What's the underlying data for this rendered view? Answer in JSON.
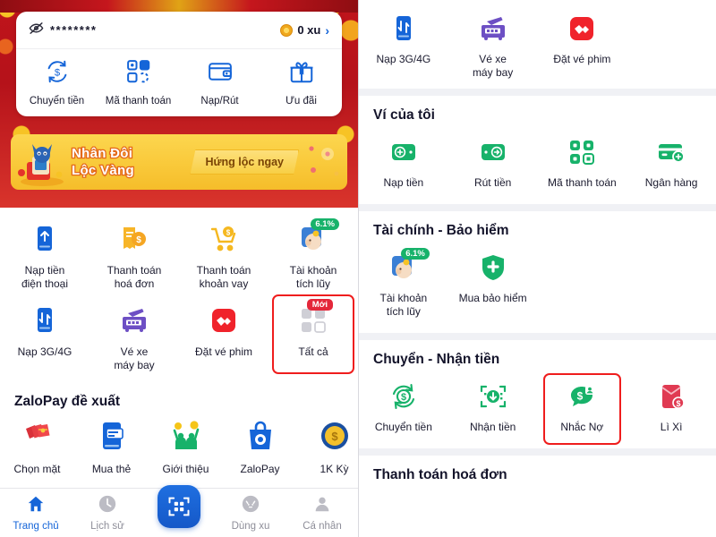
{
  "app": {
    "name": "ZaloPay",
    "language": "vi"
  },
  "colors": {
    "brand_blue": "#1565d8",
    "brand_green": "#17b26a",
    "highlight_red": "#ef1d1d",
    "badge_new_red": "#e4273a",
    "tet_red": "#c0141b",
    "promo_yellow": "#f9c93a"
  },
  "left_panel": {
    "balance_card": {
      "eye_icon": "eye-off-icon",
      "balance_masked": "********",
      "coin_icon": "coin-icon",
      "coin_value": "0 xu",
      "chevron": "chevron-right-icon",
      "quick_actions": [
        {
          "label": "Chuyển tiền",
          "icon": "transfer-money-icon"
        },
        {
          "label": "Mã thanh toán",
          "icon": "payment-qr-icon"
        },
        {
          "label": "Nạp/Rút",
          "icon": "wallet-icon"
        },
        {
          "label": "Ưu đãi",
          "icon": "gift-icon"
        }
      ]
    },
    "promo_banner": {
      "line1": "Nhân Đôi",
      "line2": "Lộc Vàng",
      "button_label": "Hứng lộc ngay",
      "mascot_icon": "cat-mascot-icon"
    },
    "services": [
      {
        "label": "Nạp tiền\nđiện thoại",
        "icon": "phone-topup-icon",
        "badge": null,
        "highlighted": false
      },
      {
        "label": "Thanh toán\nhoá đơn",
        "icon": "bill-payment-icon",
        "badge": null,
        "highlighted": false
      },
      {
        "label": "Thanh toán\nkhoản vay",
        "icon": "loan-payment-icon",
        "badge": null,
        "highlighted": false
      },
      {
        "label": "Tài khoản\ntích lũy",
        "icon": "savings-piggy-icon",
        "badge": "6.1%",
        "highlighted": false
      },
      {
        "label": "Nạp 3G/4G",
        "icon": "data-topup-icon",
        "badge": null,
        "highlighted": false
      },
      {
        "label": "Vé xe\nmáy bay",
        "icon": "travel-ticket-icon",
        "badge": null,
        "highlighted": false
      },
      {
        "label": "Đặt vé phim",
        "icon": "movie-ticket-icon",
        "badge": null,
        "highlighted": false
      },
      {
        "label": "Tất cả",
        "icon": "all-services-grid-icon",
        "badge": "Mới",
        "highlighted": true
      }
    ],
    "suggest_title": "ZaloPay đề xuất",
    "suggestions": [
      {
        "label": "Chọn mặt",
        "icon": "red-envelope-icon"
      },
      {
        "label": "Mua thẻ",
        "icon": "buy-card-icon"
      },
      {
        "label": "Giới thiệu",
        "icon": "referral-icon"
      },
      {
        "label": "ZaloPay",
        "icon": "zalopay-shop-icon"
      },
      {
        "label": "1K Kỳ",
        "icon": "coin-deal-icon"
      }
    ],
    "tabbar": [
      {
        "label": "Trang chủ",
        "icon": "home-icon",
        "active": true
      },
      {
        "label": "Lịch sử",
        "icon": "history-clock-icon",
        "active": false
      },
      {
        "label": "",
        "icon": "qr-scan-icon",
        "active": false
      },
      {
        "label": "Dùng xu",
        "icon": "coin-cat-icon",
        "active": false
      },
      {
        "label": "Cá nhân",
        "icon": "person-icon",
        "active": false
      }
    ]
  },
  "right_panel": {
    "top_row": [
      {
        "label": "Nạp 3G/4G",
        "icon": "data-topup-icon"
      },
      {
        "label": "Vé xe\nmáy bay",
        "icon": "travel-ticket-icon"
      },
      {
        "label": "Đặt vé phim",
        "icon": "movie-ticket-icon"
      }
    ],
    "sections": [
      {
        "title": "Ví của tôi",
        "items": [
          {
            "label": "Nạp tiền",
            "icon": "wallet-add-icon",
            "badge": null,
            "highlighted": false
          },
          {
            "label": "Rút tiền",
            "icon": "wallet-withdraw-icon",
            "badge": null,
            "highlighted": false
          },
          {
            "label": "Mã thanh toán",
            "icon": "payment-qr-icon",
            "badge": null,
            "highlighted": false
          },
          {
            "label": "Ngân hàng",
            "icon": "bank-card-icon",
            "badge": null,
            "highlighted": false
          }
        ]
      },
      {
        "title": "Tài chính - Bảo hiểm",
        "items": [
          {
            "label": "Tài khoản\ntích lũy",
            "icon": "savings-piggy-icon",
            "badge": "6.1%",
            "highlighted": false
          },
          {
            "label": "Mua bảo hiểm",
            "icon": "insurance-shield-icon",
            "badge": null,
            "highlighted": false
          }
        ]
      },
      {
        "title": "Chuyển - Nhận tiền",
        "items": [
          {
            "label": "Chuyển tiền",
            "icon": "transfer-money-icon",
            "badge": null,
            "highlighted": false
          },
          {
            "label": "Nhận tiền",
            "icon": "receive-qr-icon",
            "badge": null,
            "highlighted": false
          },
          {
            "label": "Nhắc Nợ",
            "icon": "debt-reminder-icon",
            "badge": null,
            "highlighted": true
          },
          {
            "label": "Lì Xì",
            "icon": "lucky-money-icon",
            "badge": null,
            "highlighted": false
          }
        ]
      },
      {
        "title": "Thanh toán hoá đơn",
        "items": []
      }
    ]
  }
}
